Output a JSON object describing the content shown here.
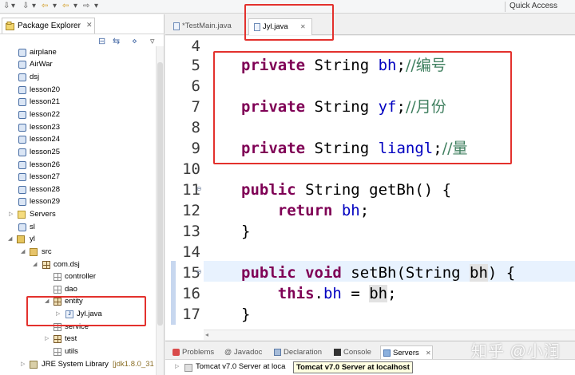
{
  "toolbar": {
    "quick_access": "Quick Access"
  },
  "package_explorer": {
    "tab_label": "Package Explorer",
    "close_glyph": "✕",
    "tree": [
      {
        "label": "airplane",
        "type": "project"
      },
      {
        "label": "AirWar",
        "type": "project"
      },
      {
        "label": "dsj",
        "type": "project"
      },
      {
        "label": "lesson20",
        "type": "project"
      },
      {
        "label": "lesson21",
        "type": "project"
      },
      {
        "label": "lesson22",
        "type": "project"
      },
      {
        "label": "lesson23",
        "type": "project"
      },
      {
        "label": "lesson24",
        "type": "project"
      },
      {
        "label": "lesson25",
        "type": "project"
      },
      {
        "label": "lesson26",
        "type": "project"
      },
      {
        "label": "lesson27",
        "type": "project"
      },
      {
        "label": "lesson28",
        "type": "project"
      },
      {
        "label": "lesson29",
        "type": "project"
      },
      {
        "label": "Servers",
        "type": "servers-folder"
      },
      {
        "label": "sl",
        "type": "project"
      },
      {
        "label": "yl",
        "type": "open-project"
      },
      {
        "label": "src",
        "type": "source-folder"
      },
      {
        "label": "com.dsj",
        "type": "package"
      },
      {
        "label": "controller",
        "type": "empty-package"
      },
      {
        "label": "dao",
        "type": "empty-package"
      },
      {
        "label": "entity",
        "type": "package"
      },
      {
        "label": "Jyl.java",
        "type": "java-file"
      },
      {
        "label": "service",
        "type": "empty-package"
      },
      {
        "label": "test",
        "type": "package"
      },
      {
        "label": "utils",
        "type": "empty-package"
      },
      {
        "label": "JRE System Library",
        "type": "library",
        "suffix": "[jdk1.8.0_31"
      }
    ]
  },
  "editor": {
    "tabs": [
      {
        "label": "*TestMain.java",
        "active": false
      },
      {
        "label": "Jyl.java",
        "active": true
      }
    ],
    "close_glyph": "✕",
    "lines": [
      {
        "num": "4"
      },
      {
        "num": "5",
        "kw": "private",
        "type": " String ",
        "field": "bh",
        "punct": ";",
        "comment": "//编号"
      },
      {
        "num": "6"
      },
      {
        "num": "7",
        "kw": "private",
        "type": " String ",
        "field": "yf",
        "punct": ";",
        "comment": "//月份"
      },
      {
        "num": "8"
      },
      {
        "num": "9",
        "kw": "private",
        "type": " String ",
        "field": "liangl",
        "punct": ";",
        "comment": "//量"
      },
      {
        "num": "10"
      },
      {
        "num": "11",
        "kw": "public",
        "rest": " String getBh() {"
      },
      {
        "num": "12",
        "kw": "return",
        "field": "bh",
        "punct": ";"
      },
      {
        "num": "13",
        "rest": "}"
      },
      {
        "num": "14"
      },
      {
        "num": "15",
        "kw": "public",
        "kw2": "void",
        "rest": " setBh(String ",
        "param": "bh",
        "rest2": ") {"
      },
      {
        "num": "16",
        "kw": "this",
        "field": "bh",
        "param": "bh"
      },
      {
        "num": "17",
        "rest": "}"
      }
    ]
  },
  "bottom_panel": {
    "tabs": [
      "Problems",
      "Javadoc",
      "Declaration",
      "Console",
      "Servers"
    ],
    "server_row": "Tomcat v7.0 Server at loca",
    "tooltip": "Tomcat v7.0 Server at localhost"
  },
  "watermark": "知乎 @小润"
}
